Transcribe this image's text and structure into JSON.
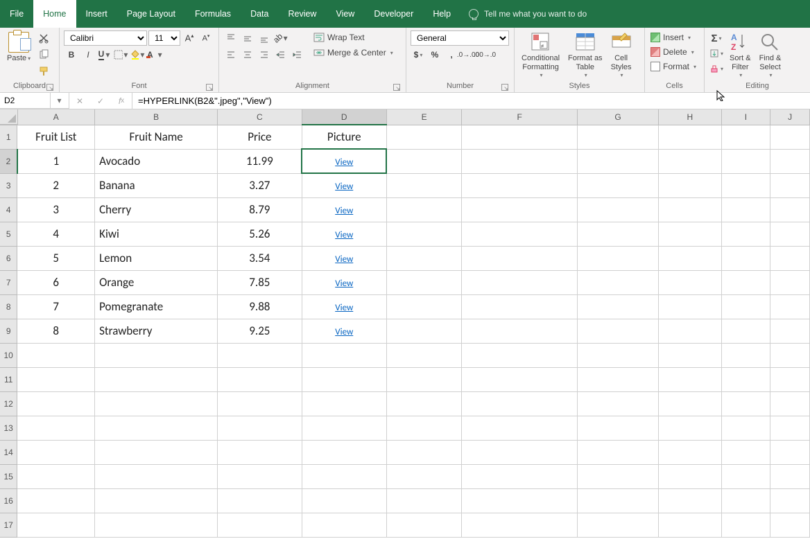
{
  "tabs": {
    "file": "File",
    "home": "Home",
    "insert": "Insert",
    "page_layout": "Page Layout",
    "formulas": "Formulas",
    "data": "Data",
    "review": "Review",
    "view": "View",
    "developer": "Developer",
    "help": "Help",
    "tell_me": "Tell me what you want to do"
  },
  "clipboard": {
    "paste": "Paste",
    "label": "Clipboard"
  },
  "font": {
    "name": "Calibri",
    "size": "11",
    "label": "Font"
  },
  "alignment": {
    "wrap": "Wrap Text",
    "merge": "Merge & Center",
    "label": "Alignment"
  },
  "number": {
    "format": "General",
    "label": "Number"
  },
  "styles": {
    "cond": "Conditional\nFormatting",
    "table": "Format as\nTable",
    "cell": "Cell\nStyles",
    "label": "Styles"
  },
  "cells": {
    "insert": "Insert",
    "delete": "Delete",
    "format": "Format",
    "label": "Cells"
  },
  "editing": {
    "sort": "Sort &\nFilter",
    "find": "Find &\nSelect",
    "label": "Editing"
  },
  "namebox": "D2",
  "formula": "=HYPERLINK(B2&\".jpeg\",\"View\")",
  "columns": [
    {
      "letter": "A",
      "w": 120
    },
    {
      "letter": "B",
      "w": 186
    },
    {
      "letter": "C",
      "w": 130
    },
    {
      "letter": "D",
      "w": 130
    },
    {
      "letter": "E",
      "w": 120
    },
    {
      "letter": "F",
      "w": 186
    },
    {
      "letter": "G",
      "w": 130
    },
    {
      "letter": "H",
      "w": 100
    },
    {
      "letter": "I",
      "w": 78
    },
    {
      "letter": "J",
      "w": 62
    }
  ],
  "headers": {
    "a": "Fruit List",
    "b": "Fruit Name",
    "c": "Price",
    "d": "Picture"
  },
  "rows": [
    {
      "n": 1,
      "name": "Avocado",
      "price": "11.99",
      "pic": "View"
    },
    {
      "n": 2,
      "name": "Banana",
      "price": "3.27",
      "pic": "View"
    },
    {
      "n": 3,
      "name": "Cherry",
      "price": "8.79",
      "pic": "View"
    },
    {
      "n": 4,
      "name": "Kiwi",
      "price": "5.26",
      "pic": "View"
    },
    {
      "n": 5,
      "name": "Lemon",
      "price": "3.54",
      "pic": "View"
    },
    {
      "n": 6,
      "name": "Orange",
      "price": "7.85",
      "pic": "View"
    },
    {
      "n": 7,
      "name": "Pomegranate",
      "price": "9.88",
      "pic": "View"
    },
    {
      "n": 8,
      "name": "Strawberry",
      "price": "9.25",
      "pic": "View"
    }
  ],
  "empty_rows": [
    10,
    11,
    12,
    13,
    14,
    15,
    16,
    17
  ],
  "selected": {
    "col": "D",
    "row": 2
  }
}
